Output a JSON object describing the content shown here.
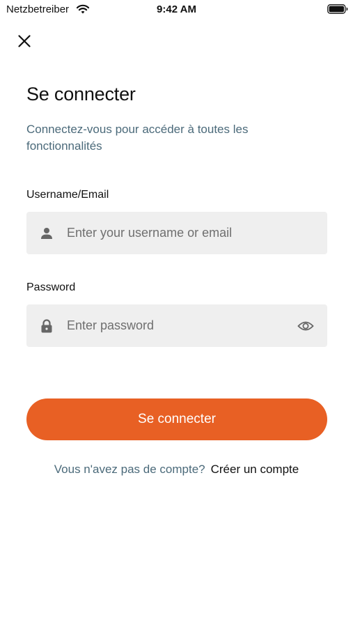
{
  "status_bar": {
    "carrier": "Netzbetreiber",
    "time": "9:42 AM"
  },
  "icons": {
    "close": "close-icon",
    "user": "user-icon",
    "lock": "lock-icon",
    "eye": "eye-icon"
  },
  "header": {
    "title": "Se connecter",
    "subtitle": "Connectez-vous pour accéder à toutes les fonctionnalités"
  },
  "form": {
    "username": {
      "label": "Username/Email",
      "placeholder": "Enter your username or email",
      "value": ""
    },
    "password": {
      "label": "Password",
      "placeholder": "Enter password",
      "value": ""
    },
    "submit_label": "Se connecter"
  },
  "signup": {
    "prompt": "Vous n'avez pas de compte?",
    "link": "Créer un compte"
  },
  "colors": {
    "accent": "#e86024",
    "subtitle_text": "#4b6a7a",
    "field_background": "#efefef"
  }
}
